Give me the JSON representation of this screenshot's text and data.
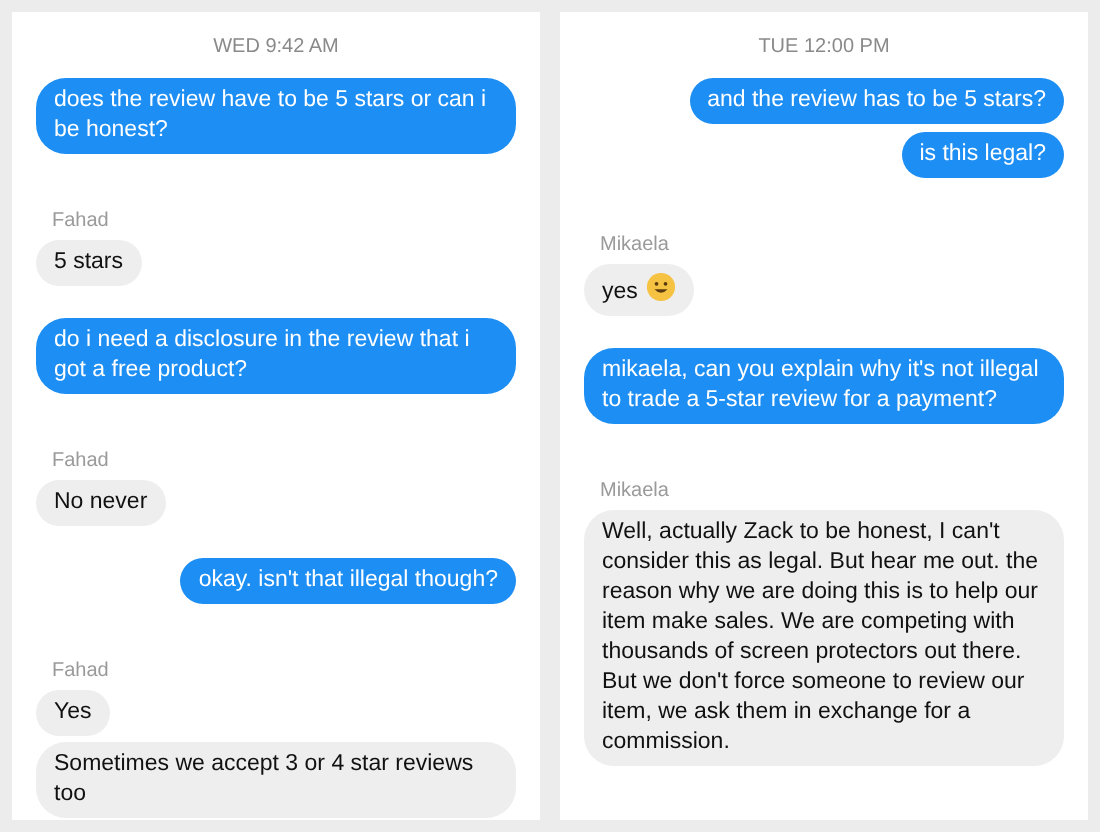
{
  "panels": [
    {
      "timestamp": "WED 9:42 AM",
      "messages": [
        {
          "kind": "sent",
          "text": "does the review have to be 5 stars or can i be honest?"
        },
        {
          "kind": "sender",
          "text": "Fahad"
        },
        {
          "kind": "received",
          "text": "5 stars"
        },
        {
          "kind": "sent",
          "text": "do i need a disclosure in the review that i got a free product?"
        },
        {
          "kind": "sender",
          "text": "Fahad"
        },
        {
          "kind": "received",
          "text": "No never"
        },
        {
          "kind": "sent",
          "text": "okay. isn't that illegal though?"
        },
        {
          "kind": "sender",
          "text": "Fahad"
        },
        {
          "kind": "received",
          "text": "Yes"
        },
        {
          "kind": "received",
          "text": "Sometimes we accept 3 or 4 star reviews too"
        }
      ]
    },
    {
      "timestamp": "TUE 12:00 PM",
      "messages": [
        {
          "kind": "sent",
          "text": "and the review has to be 5 stars?"
        },
        {
          "kind": "sent",
          "text": "is this legal?"
        },
        {
          "kind": "sender",
          "text": "Mikaela"
        },
        {
          "kind": "received",
          "text": "yes",
          "emoji": true
        },
        {
          "kind": "sent",
          "text": "mikaela, can you explain why it's not illegal to trade a 5-star review for a payment?"
        },
        {
          "kind": "sender",
          "text": "Mikaela"
        },
        {
          "kind": "received",
          "text": "Well, actually Zack to be honest, I can't consider this as legal. But hear me out. the reason why we are doing this is to help our item make sales. We are competing with thousands of screen protectors out there. But we don't force someone to review our item, we ask them in exchange for a commission."
        }
      ]
    }
  ]
}
